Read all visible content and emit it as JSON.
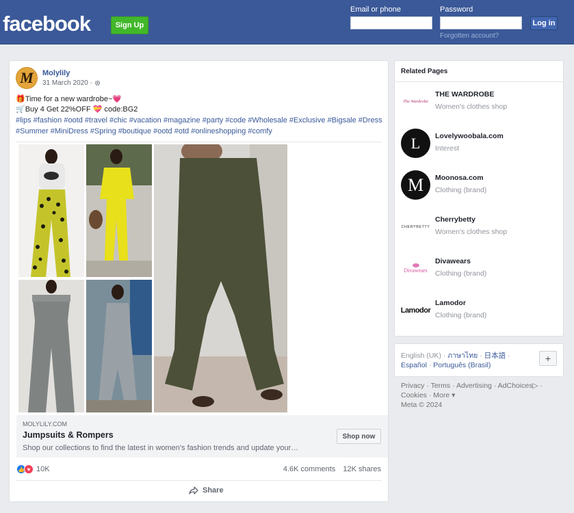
{
  "header": {
    "logo": "facebook",
    "signup_label": "Sign Up",
    "email_label": "Email or phone",
    "password_label": "Password",
    "login_label": "Log in",
    "forgot_label": "Forgotten account?",
    "bg_color": "#3b5998"
  },
  "post": {
    "author": "Molylily",
    "author_avatar_letter": "M",
    "date": "31 March 2020 ·",
    "line1": "🎁Time for a new wardrobe~💗",
    "line2": "🛒Buy 4 Get 22%OFF 💝 code:BG2",
    "hashtags": "#lips #fashion #ootd #travel #chic #vacation #magazine #party #code #Wholesale #Exclusive #Bigsale #Dress #Summer #MiniDress #Spring #boutique #ootd #otd #onlineshopping #comfy",
    "link": {
      "domain": "MOLYLILY.COM",
      "title": "Jumpsuits & Rompers",
      "description": "Shop our collections to find the latest in women's fashion trends and update your…",
      "cta": "Shop now"
    },
    "reactions_count": "10K",
    "comments": "4.6K comments",
    "shares": "12K shares",
    "share_label": "Share"
  },
  "related": {
    "title": "Related Pages",
    "pages": [
      {
        "name": "THE WARDROBE",
        "category": "Women's clothes shop",
        "logo_text": "The Wardrobe"
      },
      {
        "name": "Lovelywoobala.com",
        "category": "Interest",
        "logo_text": "L"
      },
      {
        "name": "Moonosa.com",
        "category": "Clothing (brand)",
        "logo_text": "M"
      },
      {
        "name": "Cherrybetty",
        "category": "Women's clothes shop",
        "logo_text": "CHERYBETTY"
      },
      {
        "name": "Divawears",
        "category": "Clothing (brand)",
        "logo_text": "Divawears"
      },
      {
        "name": "Lamodor",
        "category": "Clothing (brand)",
        "logo_text": "Lamodor"
      }
    ]
  },
  "languages": {
    "current": "English (UK)",
    "others": [
      "ภาษาไทย",
      "日本語",
      "Español",
      "Português (Brasil)"
    ]
  },
  "footer": {
    "links": [
      "Privacy",
      "Terms",
      "Advertising",
      "AdChoices",
      "Cookies",
      "More"
    ],
    "copyright": "Meta © 2024"
  }
}
